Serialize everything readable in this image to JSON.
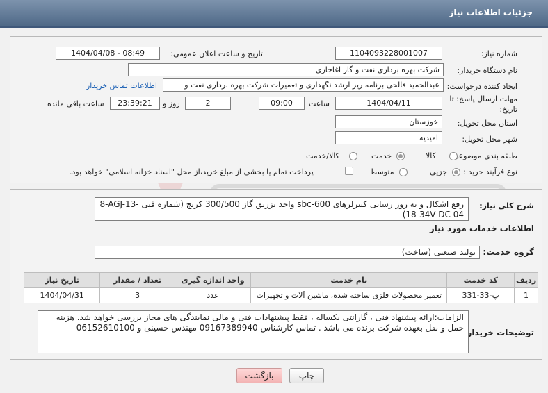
{
  "header": {
    "title": "جزئیات اطلاعات نیاز"
  },
  "form": {
    "need_number_label": "شماره نیاز:",
    "need_number": "1104093228001007",
    "announce_label": "تاریخ و ساعت اعلان عمومی:",
    "announce_value": "1404/04/08 - 08:49",
    "buyer_label": "نام دستگاه خریدار:",
    "buyer_value": "شرکت بهره برداری نفت و گاز اغاجاری",
    "creator_label": "ایجاد کننده درخواست:",
    "creator_value": "عبدالحمید فالحی برنامه ریز ارشد نگهداری و تعمیرات شرکت بهره برداری نفت و",
    "contact_link": "اطلاعات تماس خریدار",
    "deadline_label_1": "مهلت ارسال پاسخ: تا",
    "deadline_label_2": "تاریخ:",
    "deadline_date": "1404/04/11",
    "time_label": "ساعت",
    "deadline_time": "09:00",
    "days_value": "2",
    "days_label": "روز و",
    "remaining_time": "23:39:21",
    "remaining_label": "ساعت باقی مانده",
    "province_label": "استان محل تحویل:",
    "province_value": "خوزستان",
    "city_label": "شهر محل تحویل:",
    "city_value": "امیدیه",
    "category_label": "طبقه بندی موضوعی:",
    "category_options": [
      "کالا",
      "خدمت",
      "کالا/خدمت"
    ],
    "process_label": "نوع فرآیند خرید :",
    "process_options": [
      "جزیی",
      "متوسط"
    ],
    "payment_note": "پرداخت تمام یا بخشی از مبلغ خرید،از محل \"اسناد خزانه اسلامی\" خواهد بود."
  },
  "description": {
    "label": "شرح کلی نیاز:",
    "line1": "رفع اشکال و به روز رسانی کنترلرهای sbc-600 واحد تزریق گاز 300/500  کرنج (شماره فنی -s/n:88-AGJ-13",
    "line2": "18-34V DC   04)"
  },
  "services": {
    "section_title": "اطلاعات خدمات مورد نیاز",
    "group_label": "گروه خدمت:",
    "group_value": "تولید صنعتی (ساخت)",
    "columns": [
      "ردیف",
      "کد خدمت",
      "نام خدمت",
      "واحد اندازه گیری",
      "تعداد / مقدار",
      "تاریخ نیاز"
    ],
    "rows": [
      [
        "1",
        "پ-33-331",
        "تعمیر محصولات فلزی ساخته شده، ماشین آلات و تجهیزات",
        "عدد",
        "3",
        "1404/04/31"
      ]
    ]
  },
  "notes": {
    "label": "توضیحات خریدار:",
    "line1": "الزامات:ارائه پیشنهاد فنی ، گارانتی یکساله ، فقط پیشنهادات فنی و مالی نمایندگی های مجاز بررسی خواهد شد.  هزینه",
    "line2": "حمل و نقل بعهده شرکت برنده می باشد . تماس کارشناس 09167389940 مهندس حسینی و 06152610100"
  },
  "buttons": {
    "print": "چاپ",
    "back": "بازگشت"
  },
  "colors": {
    "header": "#5a7394",
    "link": "#1a5fb4",
    "watermark": "#cc2a2a"
  }
}
